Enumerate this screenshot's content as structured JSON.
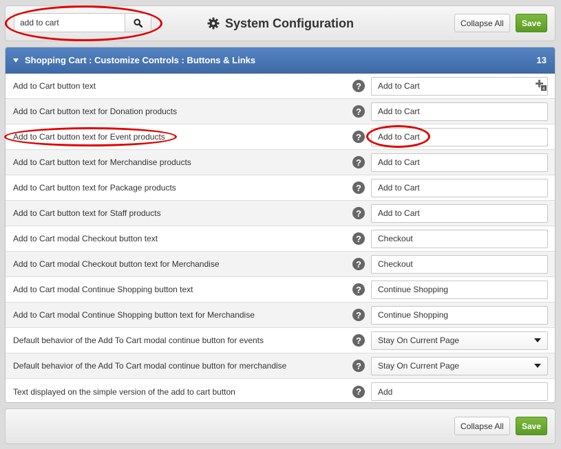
{
  "toolbar": {
    "search": {
      "value": "add to cart",
      "placeholder": ""
    },
    "title": "System Configuration",
    "collapse_label": "Collapse All",
    "save_label": "Save"
  },
  "panel": {
    "title": "Shopping Cart : Customize Controls : Buttons & Links",
    "count": "13",
    "rows": [
      {
        "label": "Add to Cart button text",
        "value": "Add to Cart",
        "type": "text"
      },
      {
        "label": "Add to Cart button text for Donation products",
        "value": "Add to Cart",
        "type": "text"
      },
      {
        "label": "Add to Cart button text for Event products",
        "value": "Add to Cart",
        "type": "text"
      },
      {
        "label": "Add to Cart button text for Merchandise products",
        "value": "Add to Cart",
        "type": "text"
      },
      {
        "label": "Add to Cart button text for Package products",
        "value": "Add to Cart",
        "type": "text"
      },
      {
        "label": "Add to Cart button text for Staff products",
        "value": "Add to Cart",
        "type": "text"
      },
      {
        "label": "Add to Cart modal Checkout button text",
        "value": "Checkout",
        "type": "text"
      },
      {
        "label": "Add to Cart modal Checkout button text for Merchandise",
        "value": "Checkout",
        "type": "text"
      },
      {
        "label": "Add to Cart modal Continue Shopping button text",
        "value": "Continue Shopping",
        "type": "text"
      },
      {
        "label": "Add to Cart modal Continue Shopping button text for Merchandise",
        "value": "Continue Shopping",
        "type": "text"
      },
      {
        "label": "Default behavior of the Add To Cart modal continue button for events",
        "value": "Stay On Current Page",
        "type": "select"
      },
      {
        "label": "Default behavior of the Add To Cart modal continue button for merchandise",
        "value": "Stay On Current Page",
        "type": "select"
      },
      {
        "label": "Text displayed on the simple version of the add to cart button",
        "value": "Add",
        "type": "text"
      }
    ]
  },
  "bottombar": {
    "collapse_label": "Collapse All",
    "save_label": "Save"
  },
  "icons": {
    "search": "search-icon",
    "gear": "gear-icon",
    "help": "help-icon",
    "translate": "translate-icon",
    "caret": "caret-down-icon"
  },
  "colors": {
    "header_blue": "#4a77b6",
    "save_green": "#6aa82f",
    "annotation_red": "#e00000"
  },
  "help_glyph": "?"
}
